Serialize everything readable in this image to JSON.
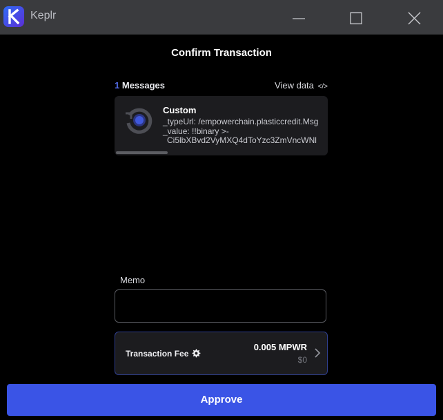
{
  "window": {
    "title": "Keplr",
    "icons": [
      "keplr-logo-icon",
      "minimize-icon",
      "maximize-icon",
      "close-icon"
    ]
  },
  "page": {
    "title": "Confirm Transaction"
  },
  "messages": {
    "count": "1",
    "label": "Messages",
    "view_data": "View data",
    "view_data_icon": "</>",
    "items": [
      {
        "title": "Custom",
        "type_url_line": "_typeUrl: /empowerchain.plasticcredit.Msg",
        "value_line": "_value: !!binary >-",
        "binary_line": "Ci5lbXBvd2VyMXQ4dToYzc3ZmVncWNl",
        "icon": "custom-message-icon"
      }
    ]
  },
  "memo": {
    "label": "Memo",
    "value": "",
    "placeholder": ""
  },
  "fee": {
    "label": "Transaction Fee",
    "amount": "0.005 MPWR",
    "usd": "$0",
    "icons": [
      "gear-icon",
      "chevron-right-icon"
    ]
  },
  "actions": {
    "approve": "Approve"
  },
  "colors": {
    "accent": "#3a54e6",
    "count": "#566ff0",
    "titlebar": "#3a3b3e",
    "card": "#1c1c1f",
    "background": "#000000"
  }
}
